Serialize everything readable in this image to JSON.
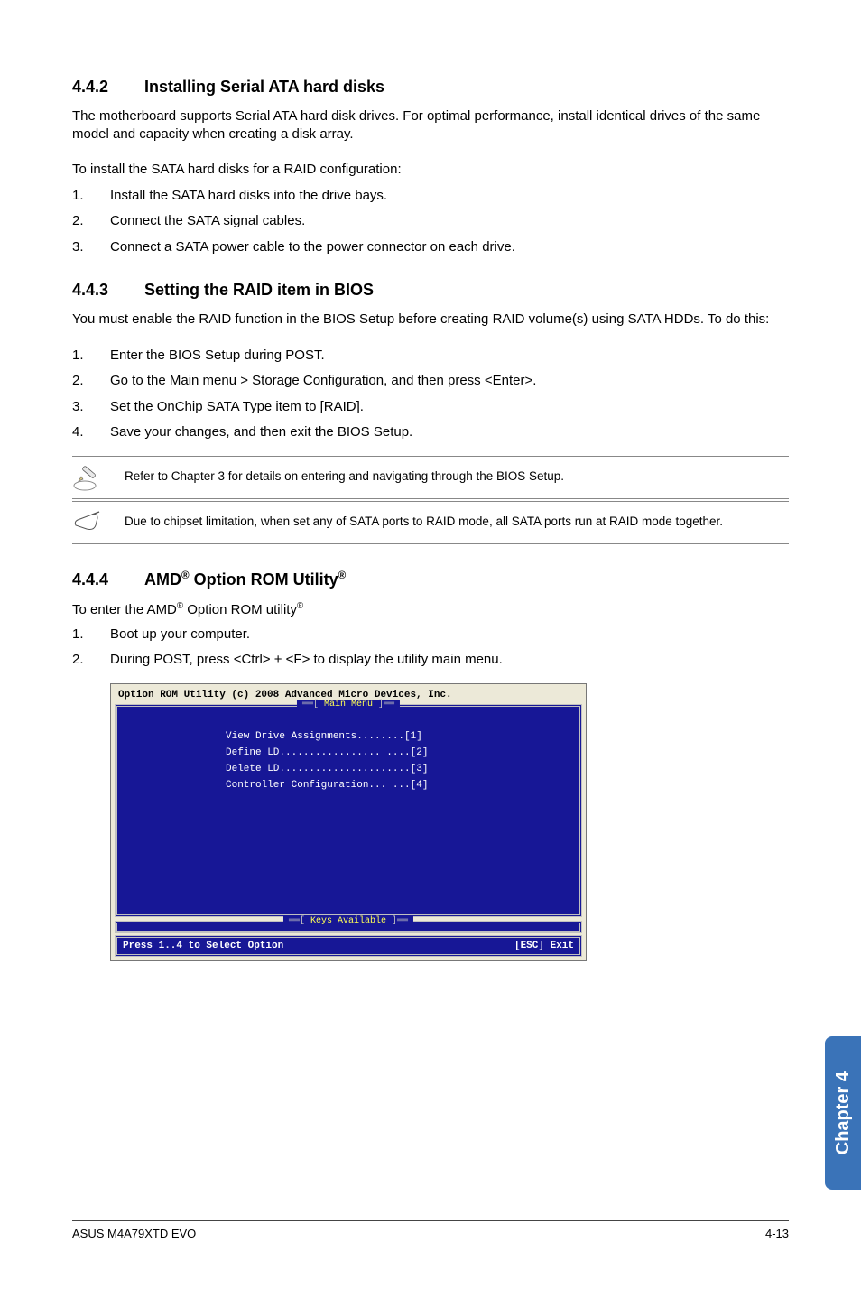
{
  "s442": {
    "num": "4.4.2",
    "title": "Installing Serial ATA hard disks",
    "p1": "The motherboard supports Serial ATA hard disk drives. For optimal performance, install identical drives of the same model and capacity when creating a disk array.",
    "p2": "To install the SATA hard disks for a RAID configuration:",
    "steps": [
      "Install the SATA hard disks into the drive bays.",
      "Connect the SATA signal cables.",
      "Connect a SATA power cable to the power connector on each drive."
    ]
  },
  "s443": {
    "num": "4.4.3",
    "title": "Setting the RAID item in BIOS",
    "p1": "You must enable the RAID function in the BIOS Setup before creating RAID volume(s) using SATA HDDs. To do this:",
    "steps": [
      "Enter the BIOS Setup during POST.",
      "Go to the Main menu > Storage Configuration, and then press <Enter>.",
      "Set the OnChip SATA Type item to [RAID].",
      "Save your changes, and then exit the BIOS Setup."
    ],
    "note1": "Refer to Chapter 3 for details on entering and navigating through the BIOS Setup.",
    "note2": "Due to chipset limitation, when set any of SATA ports to RAID mode, all SATA ports run at RAID mode together."
  },
  "s444": {
    "num": "4.4.4",
    "title_prefix": "AMD",
    "title_mid": " Option ROM Utility",
    "p1_prefix": "To enter the AMD",
    "p1_mid": " Option ROM utility",
    "steps": [
      "Boot up your computer.",
      "During POST, press <Ctrl> + <F> to display the utility main menu."
    ]
  },
  "bios": {
    "header": "Option ROM Utility (c) 2008 Advanced Micro Devices, Inc.",
    "main_label": "[ Main Menu ]",
    "lines": [
      "View Drive Assignments........[1]",
      "Define LD................. ....[2]",
      "Delete LD......................[3]",
      "Controller Configuration... ...[4]"
    ],
    "keys_label": "[ Keys Available ]",
    "footer_left": "Press 1..4 to Select Option",
    "footer_right": "[ESC] Exit"
  },
  "sidetab": "Chapter 4",
  "footer": {
    "left": "ASUS M4A79XTD EVO",
    "right": "4-13"
  }
}
